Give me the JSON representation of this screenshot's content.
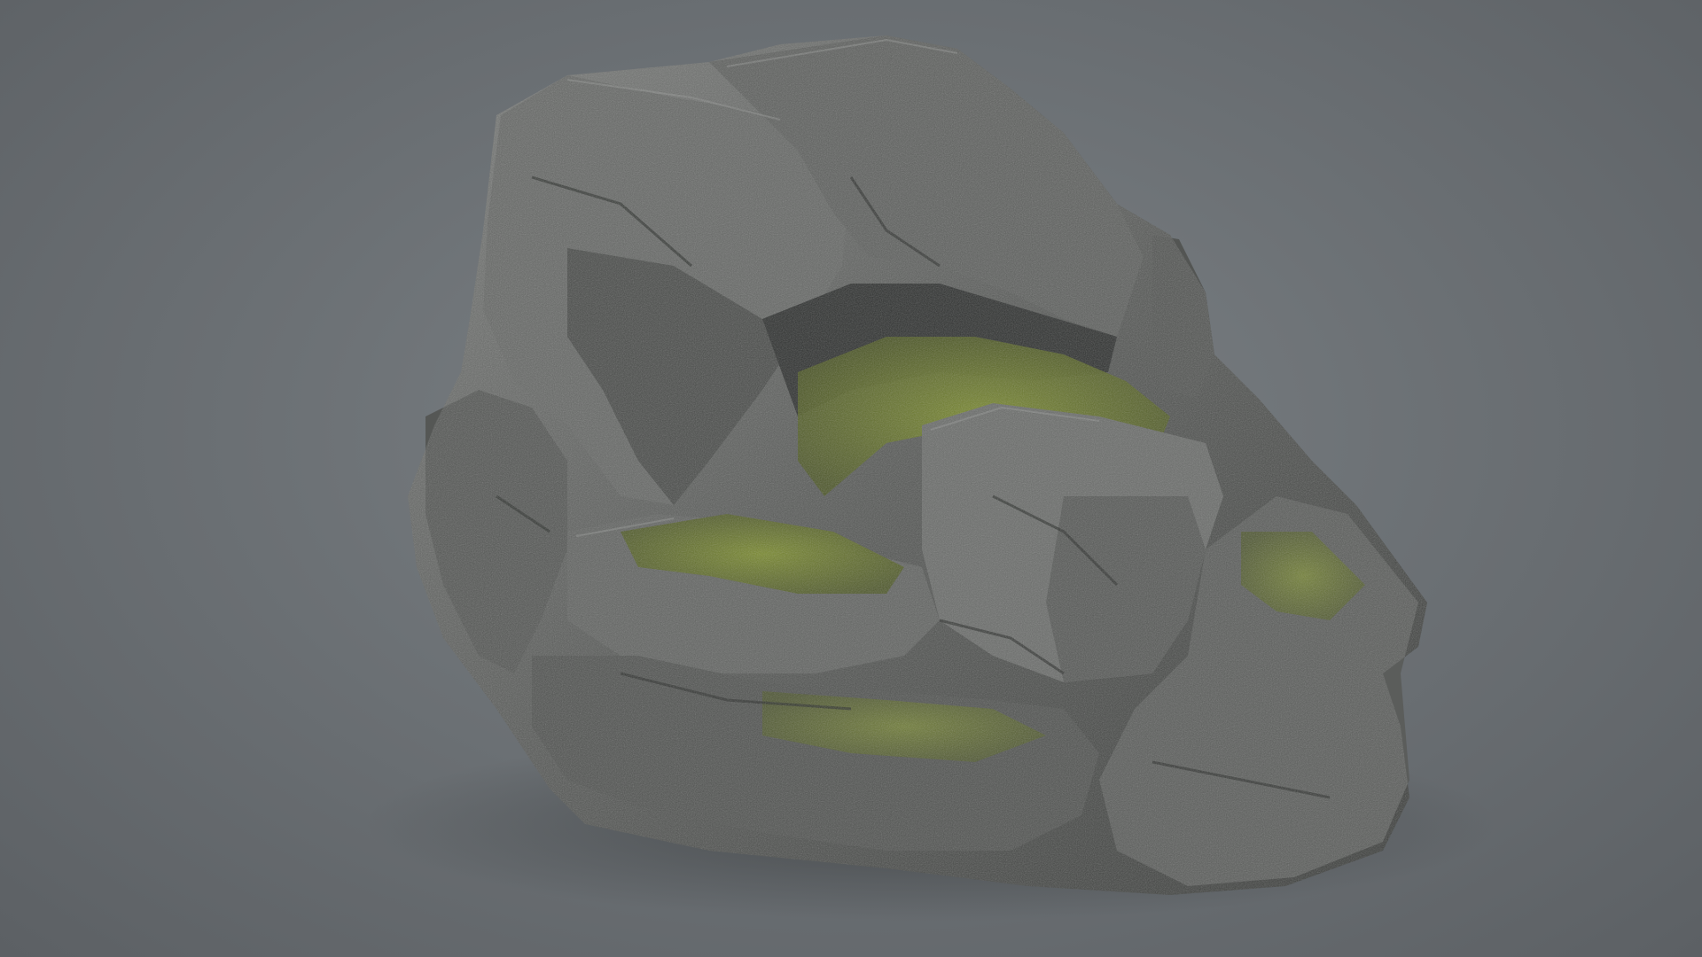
{
  "scene": {
    "subject": "mossy-rock-3d-model",
    "colors": {
      "background_center": "#7d8286",
      "background_edge": "#5c6064",
      "rock_base": "#585a58",
      "rock_light": "#8a8c8a",
      "rock_dark": "#2e302e",
      "moss": "#6b7a2a",
      "moss_dark": "#4a5520"
    }
  }
}
